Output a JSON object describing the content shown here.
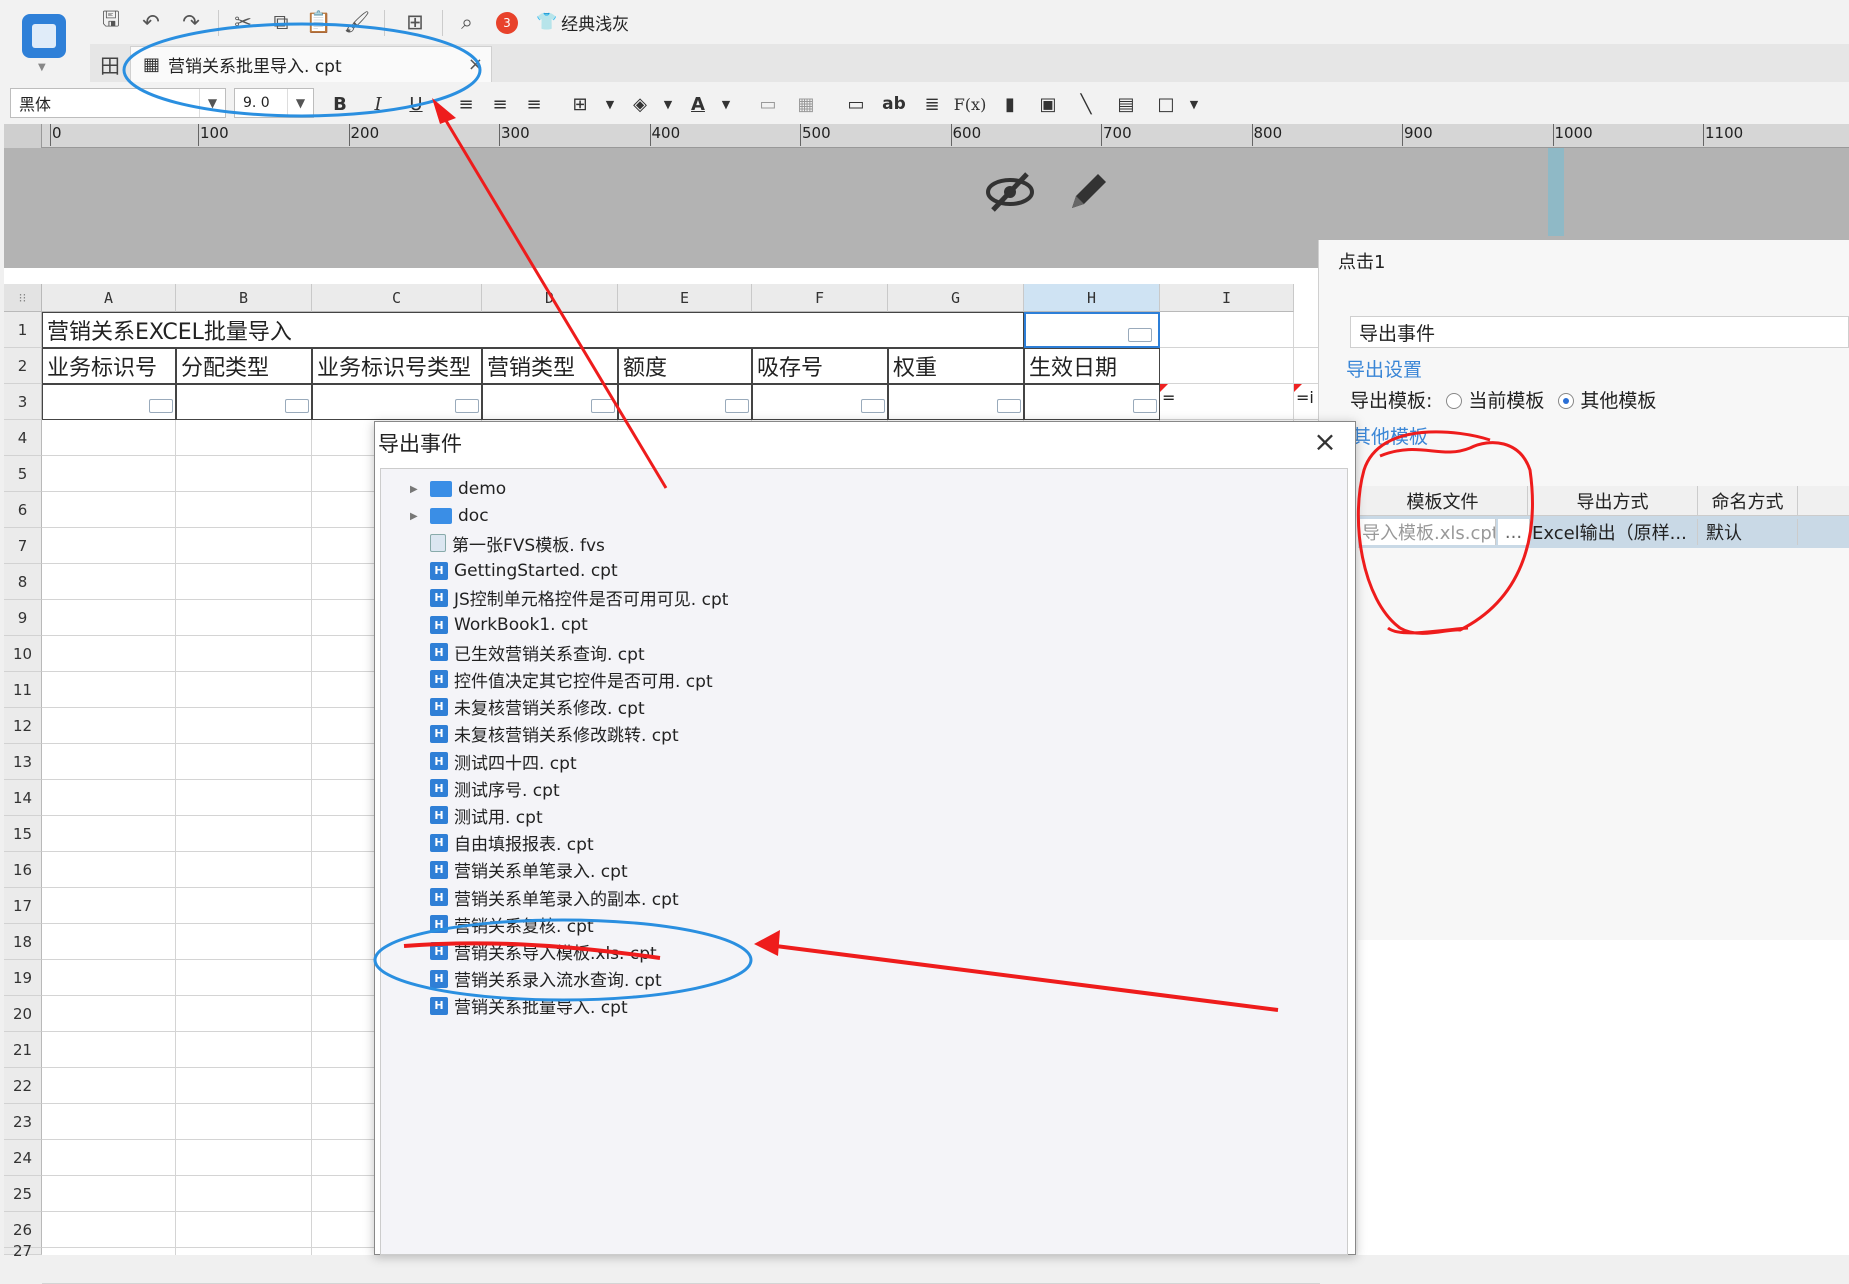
{
  "toolbar": {
    "notif_count": "3",
    "theme_label": "经典浅灰"
  },
  "tab": {
    "title": "营销关系批里导入. cpt",
    "close": "×"
  },
  "format": {
    "font": "黑体",
    "size": "9. 0",
    "bold": "B",
    "italic": "I",
    "underline": "U",
    "text_ab": "ab",
    "formula": "F(x)"
  },
  "ruler": {
    "zero": "0",
    "ticks": [
      "100",
      "200",
      "300",
      "400",
      "500",
      "600",
      "700",
      "800",
      "900",
      "1000",
      "1100"
    ]
  },
  "sheet": {
    "columns": [
      "A",
      "B",
      "C",
      "D",
      "E",
      "F",
      "G",
      "H",
      "I"
    ],
    "rows": [
      "1",
      "2",
      "3",
      "4",
      "5",
      "6",
      "7",
      "8",
      "9",
      "10",
      "11",
      "12",
      "13",
      "14",
      "15",
      "16",
      "17",
      "18",
      "19",
      "20",
      "21",
      "22",
      "23",
      "24",
      "25",
      "26",
      "27"
    ],
    "title": "营销关系EXCEL批量导入",
    "headers": [
      "业务标识号",
      "分配类型",
      "业务标识号类型",
      "营销类型",
      "额度",
      "吸存号",
      "权重",
      "生效日期"
    ],
    "formula_i": "=",
    "formula_j": "=i"
  },
  "panel": {
    "title": "点击1",
    "event": "导出事件",
    "section_export": "导出设置",
    "template_label": "导出模板:",
    "option_current": "当前模板",
    "option_other": "其他模板",
    "section_other": "其他模板",
    "col_file": "模板文件",
    "col_mode": "导出方式",
    "col_name": "命名方式",
    "row_file": "导入模板.xls.cpt",
    "row_dots": "...",
    "row_mode": "Excel输出（原样...",
    "row_name": "默认"
  },
  "dialog": {
    "title": "导出事件",
    "close": "×",
    "items": [
      {
        "label": "demo",
        "type": "folder"
      },
      {
        "label": "doc",
        "type": "folder"
      },
      {
        "label": "第一张FVS模板. fvs",
        "type": "fvs"
      },
      {
        "label": "GettingStarted. cpt",
        "type": "cpt"
      },
      {
        "label": "JS控制单元格控件是否可用可见. cpt",
        "type": "cpt"
      },
      {
        "label": "WorkBook1. cpt",
        "type": "cpt"
      },
      {
        "label": "已生效营销关系查询. cpt",
        "type": "cpt"
      },
      {
        "label": "控件值决定其它控件是否可用. cpt",
        "type": "cpt"
      },
      {
        "label": "未复核营销关系修改. cpt",
        "type": "cpt"
      },
      {
        "label": "未复核营销关系修改跳转. cpt",
        "type": "cpt"
      },
      {
        "label": "测试四十四. cpt",
        "type": "cpt"
      },
      {
        "label": "测试序号. cpt",
        "type": "cpt"
      },
      {
        "label": "测试用. cpt",
        "type": "cpt"
      },
      {
        "label": "自由填报报表. cpt",
        "type": "cpt"
      },
      {
        "label": "营销关系单笔录入. cpt",
        "type": "cpt"
      },
      {
        "label": "营销关系单笔录入的副本. cpt",
        "type": "cpt"
      },
      {
        "label": "营销关系复核. cpt",
        "type": "cpt"
      },
      {
        "label": "营销关系导入模板.xls. cpt",
        "type": "cpt"
      },
      {
        "label": "营销关系录入流水查询. cpt",
        "type": "cpt"
      },
      {
        "label": "营销关系批量导入. cpt",
        "type": "cpt"
      }
    ]
  },
  "colors": {
    "accent": "#3a86d6",
    "annotation_red": "#ee1c1c",
    "annotation_blue": "#2a8fe0"
  }
}
